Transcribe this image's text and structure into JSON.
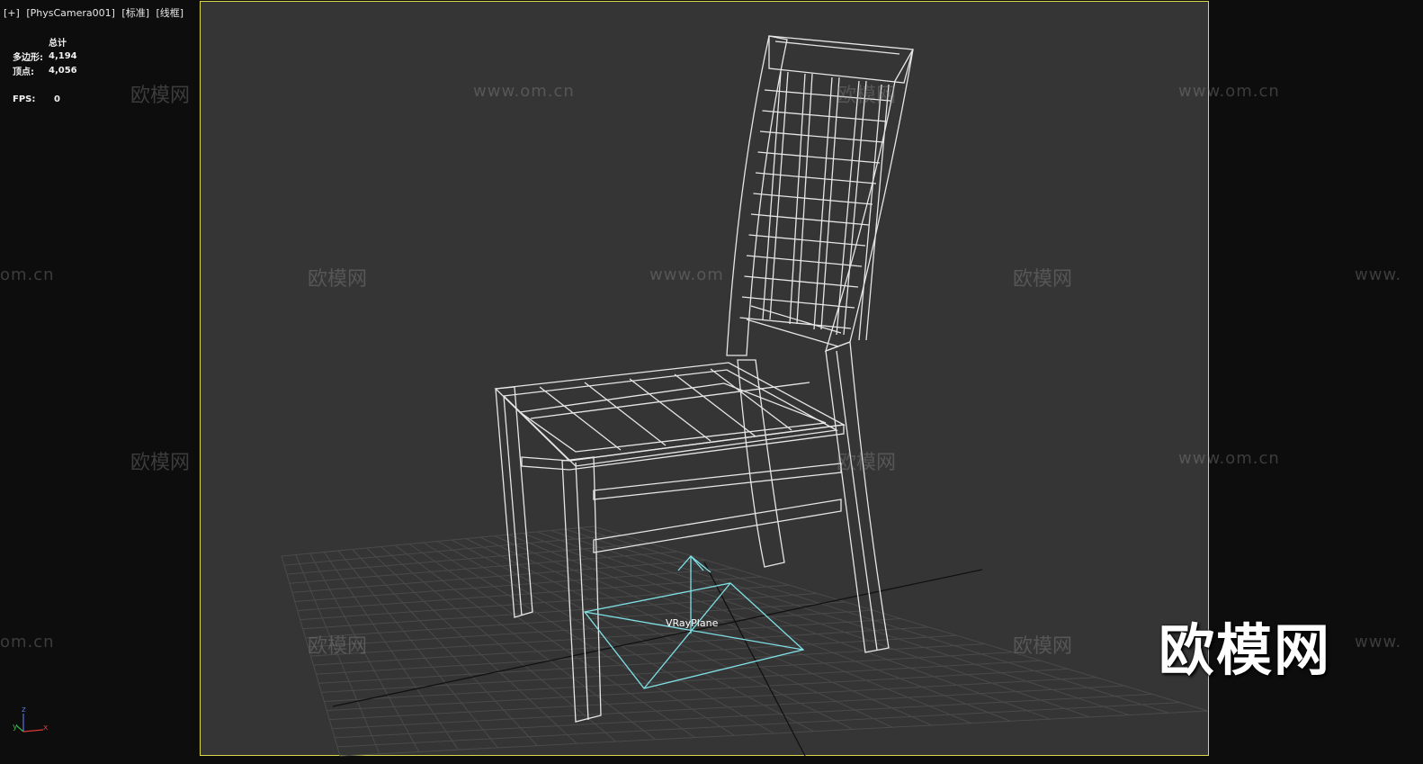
{
  "viewport": {
    "label_plus": "[+]",
    "label_camera": "[PhysCamera001]",
    "label_shading": "[标准]",
    "label_mode": "[线框]"
  },
  "stats": {
    "header": "总计",
    "polys_label": "多边形:",
    "polys_value": "4,194",
    "verts_label": "顶点:",
    "verts_value": "4,056",
    "fps_label": "FPS:",
    "fps_value": "0"
  },
  "object_label": "VRayPlane",
  "axis": {
    "z": "z",
    "x": "x",
    "y": "y"
  },
  "watermark": {
    "text": "欧模网",
    "url": "www.om.cn",
    "url_partial": "www.om",
    "url_tail": "om.cn",
    "url_head": "www."
  },
  "logo": "欧模网",
  "colors": {
    "viewport_bg": "#353535",
    "frame_border": "#d8d84a",
    "wire": "#e6e6e6",
    "helper": "#7fe0e6"
  }
}
